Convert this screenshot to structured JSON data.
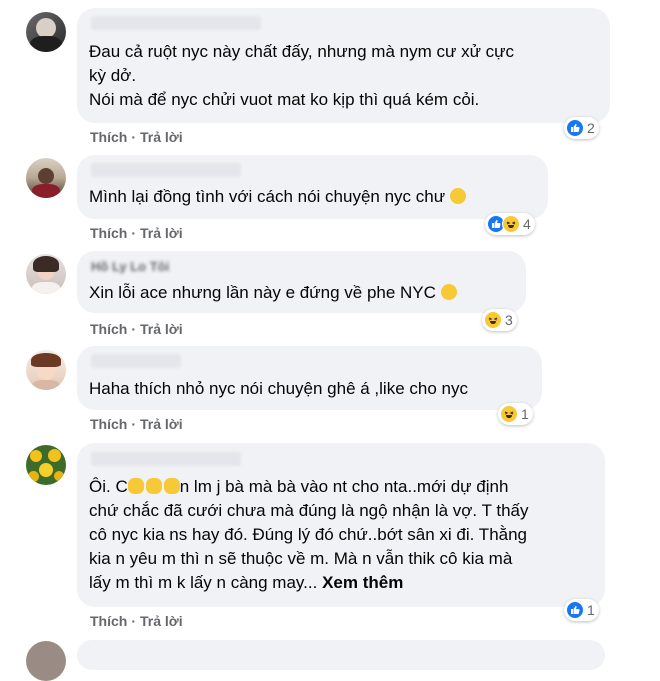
{
  "actions": {
    "like_label": "Thích",
    "reply_label": "Trả lời",
    "separator": "·"
  },
  "comments": [
    {
      "lines": [
        "Đau cả ruột nyc này chất đấy, nhưng mà nym cư xử cực",
        "kỳ dở.",
        "Nói mà để nyc chửi vuot mat ko kịp thì quá kém cỏi."
      ],
      "reactions": [
        "like-icon"
      ],
      "reaction_count": "2"
    },
    {
      "lines": [
        "Mình lại đồng tình với cách nói chuyện nyc chư"
      ],
      "reactions": [
        "like-icon",
        "haha-icon"
      ],
      "reaction_count": "4"
    },
    {
      "name_partial": "Hồ Ly Lo Tôi",
      "lines": [
        "Xin lỗi ace nhưng lần này e đứng về phe NYC"
      ],
      "reactions": [
        "haha-icon"
      ],
      "reaction_count": "3"
    },
    {
      "lines": [
        "Haha thích nhỏ nyc nói chuyện ghê á ,like cho nyc"
      ],
      "reactions": [
        "haha-icon"
      ],
      "reaction_count": "1"
    },
    {
      "line1_start": "Ôi. C",
      "line1_end": "n lm j bà mà bà vào nt cho nta..mới dự định",
      "lines": [
        "chứ chắc đã cưới chưa mà đúng là ngộ nhận là vợ. T thấy",
        "cô nyc kia ns hay đó. Đúng lý đó chứ..bớt sân xi đi. Thằng",
        "kia n yêu m thì n sẽ thuộc về m. Mà n vẫn thik cô kia mà"
      ],
      "last_line": "lấy m thì m k lấy n càng may...",
      "see_more": "Xem thêm",
      "reactions": [
        "like-icon"
      ],
      "reaction_count": "1"
    }
  ],
  "colors": {
    "bubble": "#f0f2f5",
    "like": "#1877f2",
    "haha": "#f7c937",
    "meta": "#65676b"
  }
}
